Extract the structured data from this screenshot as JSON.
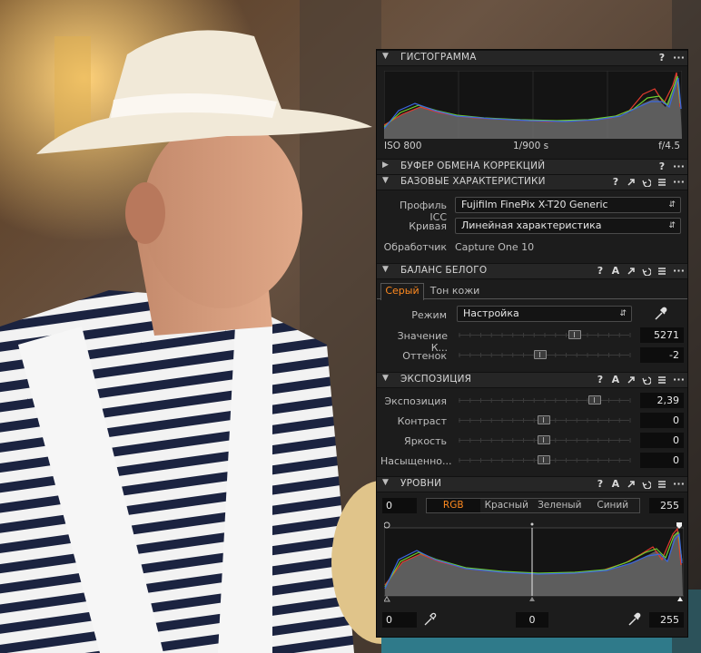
{
  "colors": {
    "panel_bg": "#1c1c1c",
    "header_bg": "#262626",
    "accent": "#ff8a1f",
    "red": "#e23b2e",
    "green": "#6fce2f",
    "blue": "#3b67e0"
  },
  "histogram": {
    "title": "ГИСТОГРАММА",
    "iso": "ISO 800",
    "shutter": "1/900 s",
    "aperture": "f/4.5"
  },
  "clipboard": {
    "title": "БУФЕР ОБМЕНА КОРРЕКЦИЙ"
  },
  "basic": {
    "title": "БАЗОВЫЕ ХАРАКТЕРИСТИКИ",
    "icc_label": "Профиль ICC",
    "icc_value": "Fujifilm FinePix X-T20 Generic",
    "curve_label": "Кривая",
    "curve_value": "Линейная характеристика",
    "engine_label": "Обработчик",
    "engine_value": "Capture One 10"
  },
  "white_balance": {
    "title": "БАЛАНС БЕЛОГО",
    "tabs": [
      "Серый",
      "Тон кожи"
    ],
    "mode_label": "Режим",
    "mode_value": "Настройка",
    "kelvin_label": "Значение К...",
    "kelvin_value": "5271",
    "kelvin_level": 0.68,
    "tint_label": "Оттенок",
    "tint_value": "-2",
    "tint_level": 0.48
  },
  "exposure": {
    "title": "ЭКСПОЗИЦИЯ",
    "rows": [
      {
        "label": "Экспозиция",
        "value": "2,39",
        "level": 0.8
      },
      {
        "label": "Контраст",
        "value": "0",
        "level": 0.5
      },
      {
        "label": "Яркость",
        "value": "0",
        "level": 0.5
      },
      {
        "label": "Насыщенно...",
        "value": "0",
        "level": 0.5
      }
    ]
  },
  "levels": {
    "title": "УРОВНИ",
    "input_low": "0",
    "input_high": "255",
    "channels": [
      "RGB",
      "Красный",
      "Зеленый",
      "Синий"
    ],
    "active_channel": "RGB",
    "output_low": "0",
    "midpoint": "0",
    "output_high": "255"
  },
  "icons": {
    "help": "?",
    "more": "···",
    "text": "A"
  }
}
